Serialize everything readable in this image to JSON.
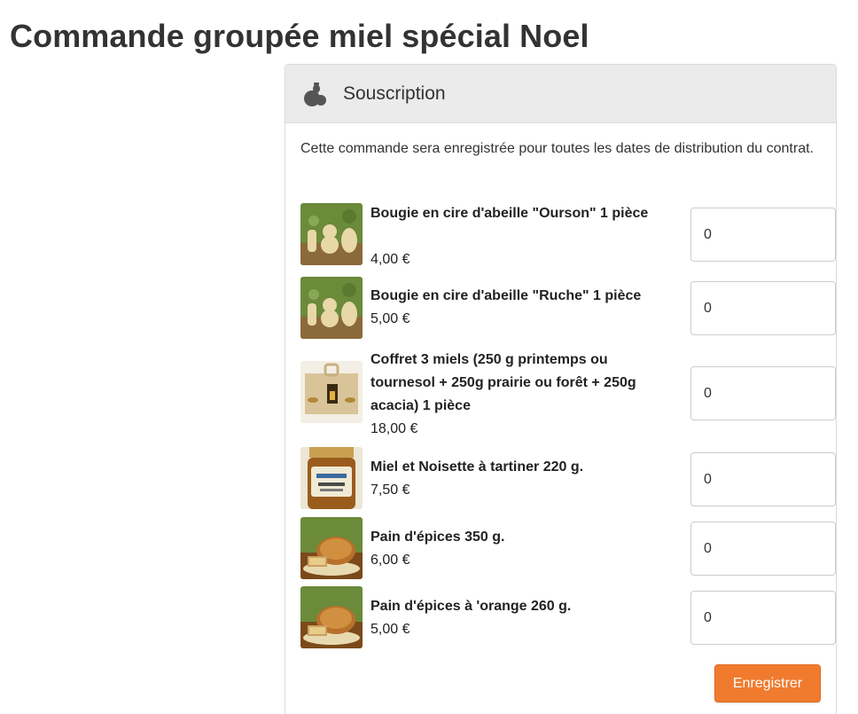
{
  "page": {
    "title": "Commande groupée miel spécial Noel"
  },
  "panel": {
    "title": "Souscription",
    "icon": "honey-pot-icon",
    "intro": "Cette commande sera enregistrée pour toutes les dates de distribution du contrat."
  },
  "products": [
    {
      "name": "Bougie en cire d'abeille \"Ourson\" 1 pièce",
      "price": "4,00 €",
      "quantity": "0",
      "image": "candle-bear-photo"
    },
    {
      "name": "Bougie en cire d'abeille \"Ruche\" 1 pièce",
      "price": "5,00 €",
      "quantity": "0",
      "image": "candle-hive-photo"
    },
    {
      "name": "Coffret 3 miels (250 g printemps ou tournesol + 250g prairie ou forêt + 250g acacia) 1 pièce",
      "price": "18,00 €",
      "quantity": "0",
      "image": "honey-gift-box-photo"
    },
    {
      "name": "Miel et Noisette à tartiner 220 g.",
      "price": "7,50 €",
      "quantity": "0",
      "image": "honey-jar-photo"
    },
    {
      "name": "Pain d'épices 350 g.",
      "price": "6,00 €",
      "quantity": "0",
      "image": "gingerbread-photo"
    },
    {
      "name": "Pain d'épices à 'orange 260 g.",
      "price": "5,00 €",
      "quantity": "0",
      "image": "gingerbread-orange-photo"
    }
  ],
  "actions": {
    "save_label": "Enregistrer"
  },
  "colors": {
    "accent": "#f07b2f",
    "heading_bg": "#ebebeb"
  }
}
